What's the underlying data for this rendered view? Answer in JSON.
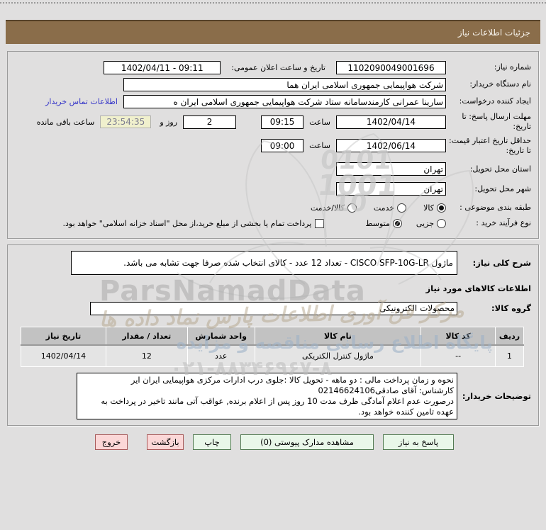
{
  "header": {
    "title": "جزئیات اطلاعات نیاز"
  },
  "form": {
    "need_number": {
      "label": "شماره نیاز:",
      "value": "1102090049001696"
    },
    "announce": {
      "label": "تاریخ و ساعت اعلان عمومی:",
      "value": "1402/04/11 - 09:11"
    },
    "buyer_org": {
      "label": "نام دستگاه خریدار:",
      "value": "شرکت هواپیمایی جمهوری اسلامی ایران هما"
    },
    "creator": {
      "label": "ایجاد کننده درخواست:",
      "value": "سارینا عمرانی کارمندسامانه ستاد شرکت هواپیمایی جمهوری اسلامی ایران ه",
      "contact_link": "اطلاعات تماس خریدار"
    },
    "reply_deadline": {
      "label": "مهلت ارسال پاسخ: تا تاریخ:",
      "date": "1402/04/14",
      "hour_label": "ساعت",
      "time": "09:15",
      "days": "2",
      "days_label": "روز و",
      "countdown": "23:54:35",
      "remaining_label": "ساعت باقی مانده"
    },
    "price_validity": {
      "label": "حداقل تاریخ اعتبار قیمت: تا تاریخ:",
      "date": "1402/06/14",
      "hour_label": "ساعت",
      "time": "09:00"
    },
    "province": {
      "label": "استان محل تحویل:",
      "value": "تهران"
    },
    "city": {
      "label": "شهر محل تحویل:",
      "value": "تهران"
    },
    "subject_class": {
      "label": "طبقه بندی موضوعی :",
      "options": [
        {
          "label": "کالا",
          "selected": true
        },
        {
          "label": "خدمت",
          "selected": false
        },
        {
          "label": "کالا/خدمت",
          "selected": false
        }
      ]
    },
    "purchase_type": {
      "label": "نوع فرآیند خرید :",
      "options": [
        {
          "label": "جزیی",
          "selected": false
        },
        {
          "label": "متوسط",
          "selected": true
        }
      ],
      "checkbox_label": "پرداخت تمام یا بخشی از مبلغ خرید،از محل \"اسناد خزانه اسلامی\" خواهد بود."
    }
  },
  "goods": {
    "overall_label": "شرح کلی نیاز:",
    "overall_value": "ماژول CISCO SFP-10G-LR - تعداد 12 عدد - کالای انتخاب شده صرفا جهت تشابه می باشد.",
    "heading": "اطلاعات کالاهای مورد نیاز",
    "group_label": "گروه کالا:",
    "group_value": "محصولات الکترونیکی",
    "table": {
      "headers": [
        "ردیف",
        "کد کالا",
        "نام کالا",
        "واحد شمارش",
        "تعداد / مقدار",
        "تاریخ نیاز"
      ],
      "rows": [
        [
          "1",
          "--",
          "ماژول کنترل الکتریکی",
          "عدد",
          "12",
          "1402/04/14"
        ]
      ]
    },
    "notes_label": "توضیحات خریدار:",
    "notes_lines": [
      "نحوه و زمان پرداخت مالی : دو ماهه - تحویل کالا :جلوی درب ادارات مرکزی هواپیمایی ایران ایر",
      "کارشناس: آقای صادقی02146624106",
      "درصورت عدم اعلام آمادگی ظرف مدت 10 روز پس از اعلام برنده, عواقب آتی مانند تاخیر در پرداخت به",
      "عهده تامین کننده خواهد بود."
    ]
  },
  "buttons": {
    "reply": "پاسخ به نیاز",
    "attachments": "مشاهده مدارک پیوستی (0)",
    "print": "چاپ",
    "back": "بازگشت",
    "exit": "خروج"
  },
  "watermark": {
    "brand": "ParsNamadData",
    "calligraphy": "مرکز فن آوری اطلاعات پارس نماد داده ها",
    "line2": "پایگاه اطلاع رسانی مناقصه و مزایده",
    "phone": "۰۲۱-۸۸۳۴۶۹۶۷-۸",
    "num1": "0101",
    "num2": "1001",
    "num3": "10"
  },
  "colors": {
    "header_brown": "#8a6d4a",
    "countdown_bg": "#f0f0cd",
    "link_blue": "#3535c8",
    "button_green": "#e9f7e9",
    "button_pink": "#fbd7d7",
    "table_header_gray": "#c2c2c2"
  }
}
